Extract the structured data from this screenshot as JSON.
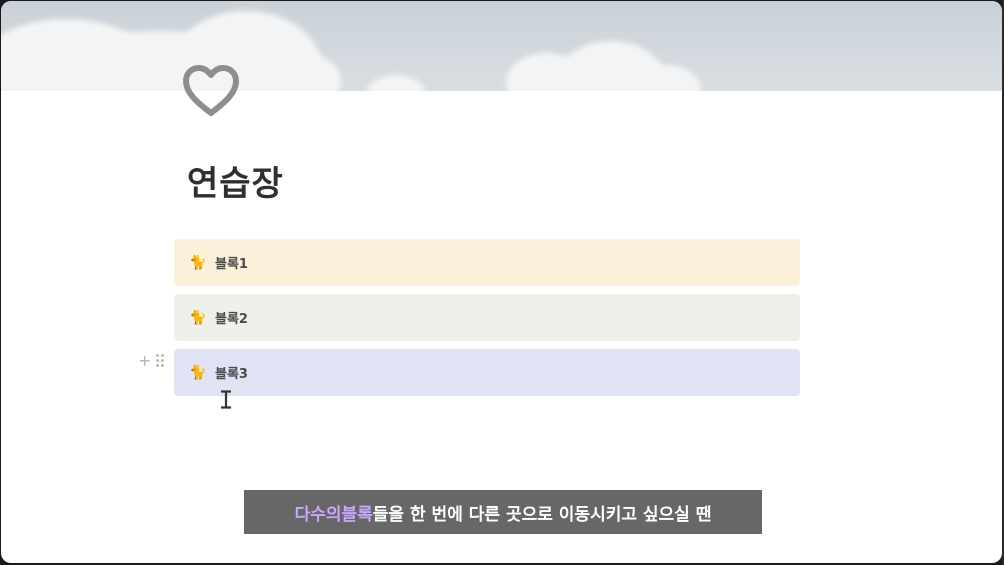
{
  "cover": {
    "description_icon": "cloud-sky-cover"
  },
  "page": {
    "icon": "heart-outline-icon",
    "title": "연습장"
  },
  "blocks": [
    {
      "emoji": "🐈",
      "label": "블록1",
      "bg": "#fbf0d9"
    },
    {
      "emoji": "🐈",
      "label": "블록2",
      "bg": "#eef0ec"
    },
    {
      "emoji": "🐈",
      "label": "블록3",
      "bg": "#e1e2f4"
    }
  ],
  "block_controls": {
    "plus": "+",
    "drag_icon": "drag-handle-icon"
  },
  "subtitle": {
    "highlight_1": "다수의 ",
    "highlight_2": "블록",
    "rest": "들을 한 번에 다른 곳으로 이동시키고 싶으실 땐",
    "highlight_color": "#cba6ff"
  }
}
